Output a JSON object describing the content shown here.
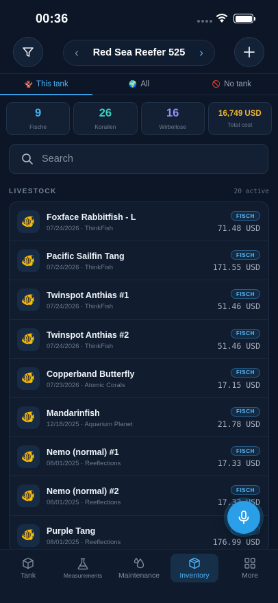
{
  "status": {
    "time": "00:36"
  },
  "header": {
    "tank_name": "Red Sea Reefer 525"
  },
  "tabs": [
    {
      "label": "This tank",
      "icon": "🪸"
    },
    {
      "label": "All",
      "icon": "🌍"
    },
    {
      "label": "No tank",
      "icon": "🚫"
    }
  ],
  "stats": [
    {
      "value": "9",
      "label": "Fische"
    },
    {
      "value": "26",
      "label": "Korallen"
    },
    {
      "value": "16",
      "label": "Wirbellose"
    },
    {
      "value": "16,749 USD",
      "label": "Total cost"
    }
  ],
  "search": {
    "placeholder": "Search"
  },
  "section": {
    "title": "LIVESTOCK",
    "count": "20 active"
  },
  "items": [
    {
      "name": "Foxface Rabbitfish - L",
      "meta": "07/24/2026 · ThinkFish",
      "badge": "FISCH",
      "price": "71.48 USD",
      "icon": "🐠"
    },
    {
      "name": "Pacific Sailfin Tang",
      "meta": "07/24/2026 · ThinkFish",
      "badge": "FISCH",
      "price": "171.55 USD",
      "icon": "🐠"
    },
    {
      "name": "Twinspot Anthias #1",
      "meta": "07/24/2026 · ThinkFish",
      "badge": "FISCH",
      "price": "51.46 USD",
      "icon": "🐠"
    },
    {
      "name": "Twinspot Anthias #2",
      "meta": "07/24/2026 · ThinkFish",
      "badge": "FISCH",
      "price": "51.46 USD",
      "icon": "🐠"
    },
    {
      "name": "Copperband Butterfly",
      "meta": "07/23/2026 · Atomic Corals",
      "badge": "FISCH",
      "price": "17.15 USD",
      "icon": "🐠"
    },
    {
      "name": "Mandarinfish",
      "meta": "12/18/2025 · Aquarium Planet",
      "badge": "FISCH",
      "price": "21.78 USD",
      "icon": "🐠"
    },
    {
      "name": "Nemo (normal) #1",
      "meta": "08/01/2025 · Reeflections",
      "badge": "FISCH",
      "price": "17.33 USD",
      "icon": "🐠"
    },
    {
      "name": "Nemo (normal) #2",
      "meta": "08/01/2025 · Reeflections",
      "badge": "FISCH",
      "price": "17.33 USD",
      "icon": "🐠"
    },
    {
      "name": "Purple Tang",
      "meta": "08/01/2025 · Reeflections",
      "badge": "FISCH",
      "price": "176.99 USD",
      "icon": "🐠"
    }
  ],
  "nav": [
    {
      "label": "Tank",
      "icon": "cube-icon"
    },
    {
      "label": "Measurements",
      "icon": "flask-icon"
    },
    {
      "label": "Maintenance",
      "icon": "drops-icon"
    },
    {
      "label": "Inventory",
      "icon": "box-icon"
    },
    {
      "label": "More",
      "icon": "grid-icon"
    }
  ],
  "colors": {
    "accent": "#3a9ee6",
    "background": "#0c1626",
    "gold": "#f1b634",
    "teal": "#3ed1c2",
    "purple": "#8d93ff"
  }
}
